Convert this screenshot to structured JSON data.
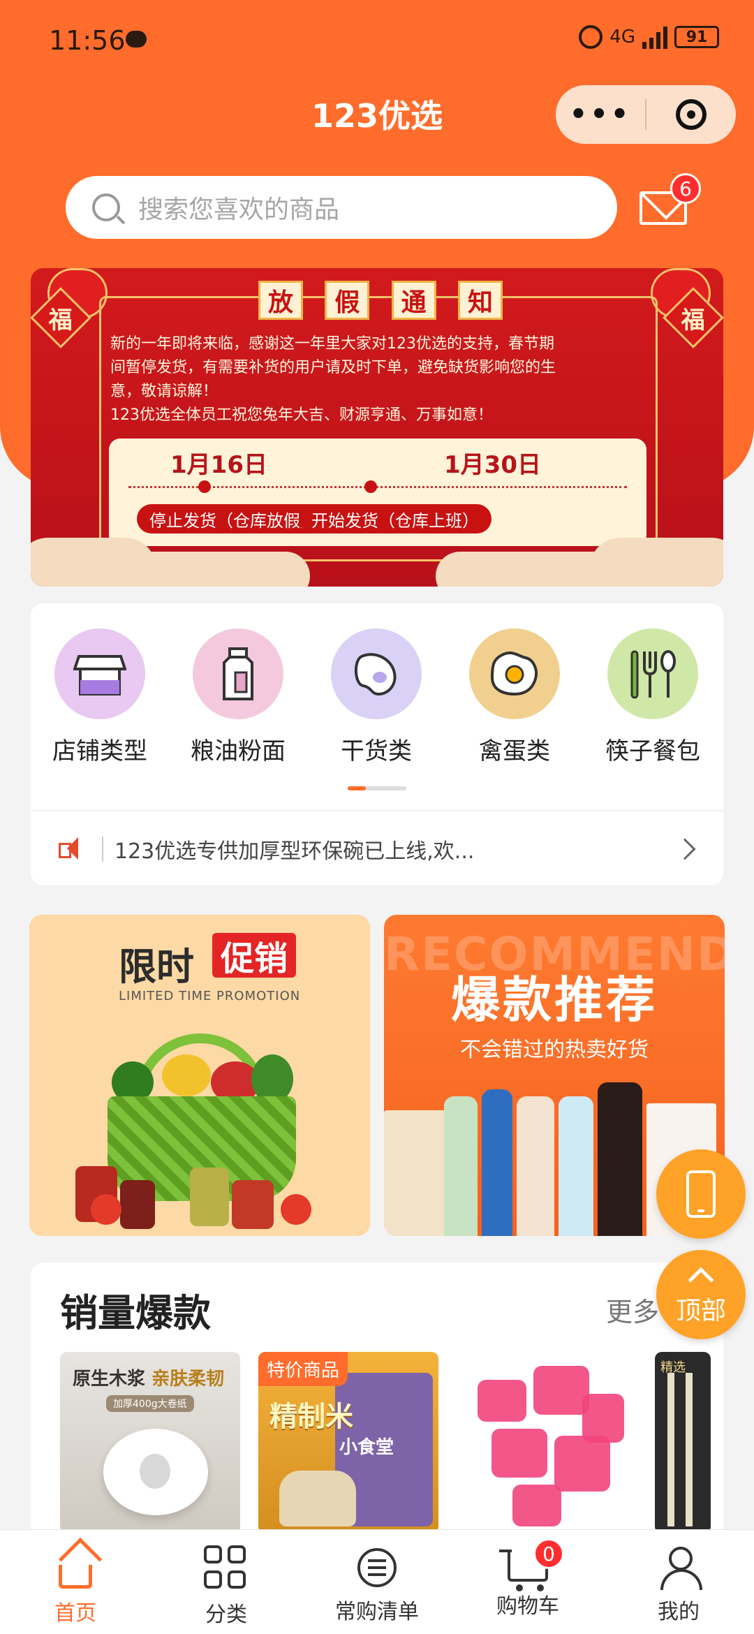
{
  "status_bar": {
    "time": "11:56",
    "network": "4G",
    "battery": "91"
  },
  "header": {
    "title": "123优选",
    "more_label": "•••"
  },
  "search": {
    "placeholder": "搜索您喜欢的商品"
  },
  "messages": {
    "badge": "6"
  },
  "banner": {
    "heading": [
      "放",
      "假",
      "通",
      "知"
    ],
    "fu": "福",
    "notice_lines": [
      "新的一年即将来临，感谢这一年里大家对123优选的支持，春节期",
      "间暂停发货，有需要补货的用户请及时下单，避免缺货影响您的生",
      "意，敬请谅解！",
      "123优选全体员工祝您兔年大吉、财源亨通、万事如意！"
    ],
    "date_stop": "1月16日",
    "stop_label": "停止发货（仓库放假）",
    "date_start": "1月30日",
    "start_label": "开始发货（仓库上班）"
  },
  "categories": [
    {
      "label": "店铺类型",
      "icon": "store-icon",
      "color": "#e9c8f2"
    },
    {
      "label": "粮油粉面",
      "icon": "grain-oil-icon",
      "color": "#f4c9dd"
    },
    {
      "label": "干货类",
      "icon": "dried-goods-icon",
      "color": "#d9d1f6"
    },
    {
      "label": "禽蛋类",
      "icon": "egg-icon",
      "color": "#f1cf8e"
    },
    {
      "label": "筷子餐包",
      "icon": "cutlery-icon",
      "color": "#cfe8a8"
    }
  ],
  "announcement": {
    "text": "123优选专供加厚型环保碗已上线,欢..."
  },
  "promo": {
    "left_title_a": "限时",
    "left_title_b": "促销",
    "left_sub": "LIMITED TIME PROMOTION",
    "right_bg": "RECOMMEND",
    "right_title": "爆款推荐",
    "right_sub": "不会错过的热卖好货"
  },
  "sales": {
    "title": "销量爆款",
    "more": "更多",
    "products": [
      {
        "text_a": "原生木浆",
        "text_b": "亲肤柔韧",
        "small": "加厚400g大卷纸"
      },
      {
        "tag": "特价商品",
        "headline": "精制米",
        "bag": "小食堂"
      },
      {
        "name": ""
      },
      {
        "label": "精选"
      }
    ]
  },
  "floating": {
    "top_label": "顶部"
  },
  "tabbar": [
    {
      "label": "首页",
      "icon": "home-icon",
      "active": true
    },
    {
      "label": "分类",
      "icon": "category-grid-icon"
    },
    {
      "label": "常购清单",
      "icon": "list-icon"
    },
    {
      "label": "购物车",
      "icon": "cart-icon",
      "badge": "0"
    },
    {
      "label": "我的",
      "icon": "user-icon"
    }
  ],
  "colors": {
    "accent": "#ff6c2c",
    "badge": "#ff2d2d",
    "float": "#ffa228"
  }
}
